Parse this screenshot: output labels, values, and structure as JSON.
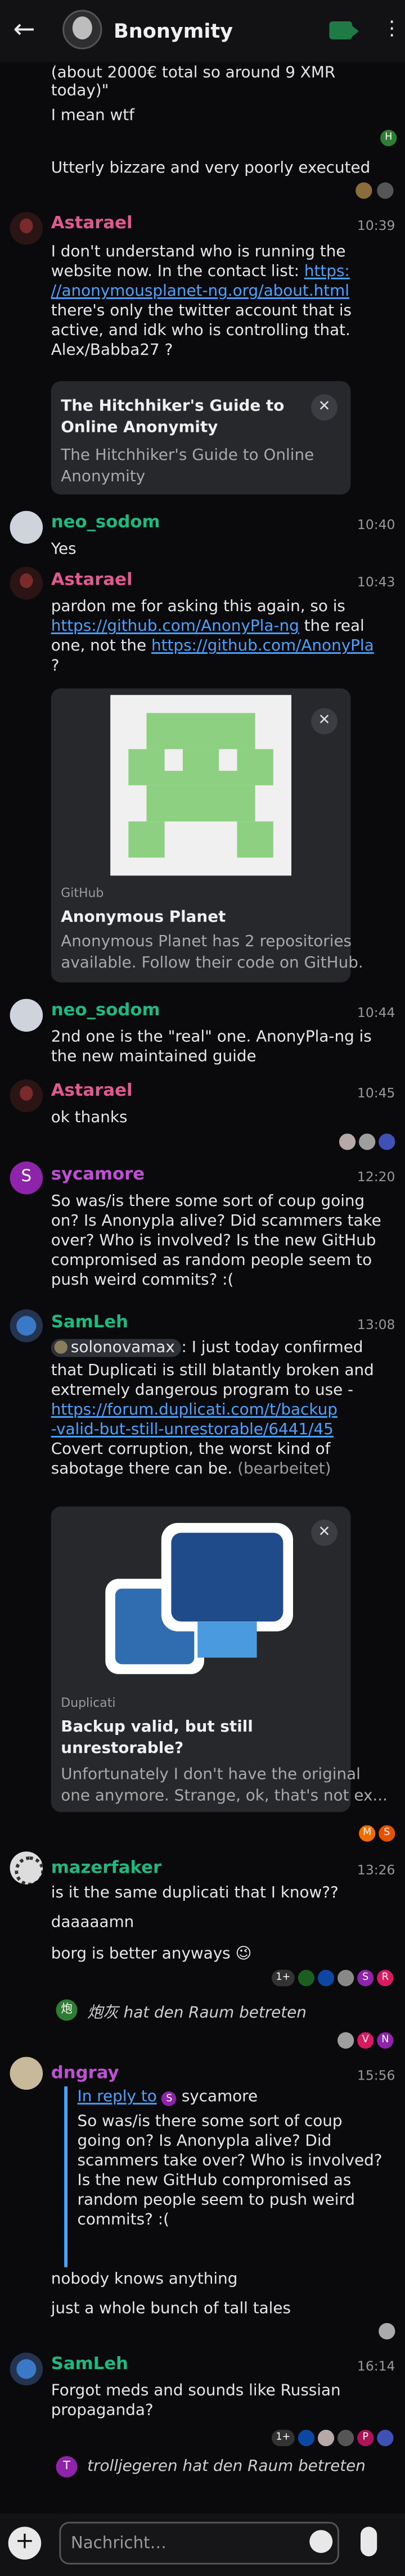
{
  "header": {
    "room_title": "Bnonymity",
    "icons": [
      "arrow-left-icon",
      "room-avatar",
      "video-call-icon",
      "kebab-menu-icon"
    ],
    "accent_color": "#1f7a46"
  },
  "colors": {
    "background": "#0a0a0c",
    "link": "#4aa3ff",
    "astarael": "#e05a8f",
    "neo_sodom": "#1eb980",
    "sycamore": "#c04fd6",
    "samleh": "#1eb980",
    "mazerfaker": "#1eb980",
    "dngray": "#c04fd6",
    "card_bg": "#27282c"
  },
  "messages": {
    "m0": {
      "lines": [
        "(about 2000€ total so around 9 XMR",
        "today)\""
      ]
    },
    "m1": {
      "text": "I mean wtf",
      "read_badge": "H"
    },
    "m2": {
      "text": "Utterly bizzare and very poorly executed"
    },
    "m3": {
      "sender": "Astarael",
      "time": "10:39",
      "line1": "I don't understand who is running the",
      "line2_pre": "website now. In the contact list: ",
      "line2_link": "https:",
      "line3_link": "//anonymousplanet-ng.org/about.html",
      "line4": "there's only the twitter account that is",
      "line5": "active, and idk who is controlling that.",
      "line6": "Alex/Babba27 ?",
      "card": {
        "title_line1": "The Hitchhiker's Guide to",
        "title_line2": "Online Anonymity",
        "desc_line1": "The Hitchhiker's Guide to Online",
        "desc_line2": "Anonymity",
        "close": "✕"
      }
    },
    "m4": {
      "sender": "neo_sodom",
      "time": "10:40",
      "text": "Yes"
    },
    "m5": {
      "sender": "Astarael",
      "time": "10:43",
      "line1": "pardon me for asking this again, so is",
      "line2_link": "https://github.com/AnonyPla-ng",
      "line2_post": " the real",
      "line3_pre": "one, not the ",
      "line3_link": "https://github.com/AnonyPla",
      "line4": "?",
      "card": {
        "site": "GitHub",
        "title": "Anonymous Planet",
        "desc_line1": "Anonymous Planet has 2 repositories",
        "desc_line2": "available. Follow their code on GitHub.",
        "close": "✕"
      }
    },
    "m6": {
      "sender": "neo_sodom",
      "time": "10:44",
      "line1": "2nd one is the \"real\" one. AnonyPla-ng is",
      "line2": "the new maintained guide"
    },
    "m7": {
      "sender": "Astarael",
      "time": "10:45",
      "text": "ok thanks"
    },
    "m8": {
      "sender": "sycamore",
      "avatar_letter": "S",
      "time": "12:20",
      "line1": "So was/is there some sort of coup going",
      "line2": "on? Is Anonypla alive? Did scammers take",
      "line3": "over? Who is involved? Is the new GitHub",
      "line4": "compromised as random people seem to",
      "line5": "push weird commits? :("
    },
    "m9": {
      "sender": "SamLeh",
      "time": "13:08",
      "mention": "solonovamax",
      "line1_post": ": I just today confirmed",
      "line2": "that Duplicati is still blatantly broken and",
      "line3": "extremely dangerous program to use -",
      "line4_link": "https://forum.duplicati.com/t/backup",
      "line5_link": "-valid-but-still-unrestorable/6441/45",
      "line6": "Covert corruption, the worst kind of",
      "line7_pre": "sabotage there can be. ",
      "edited": "(bearbeitet)",
      "card": {
        "site": "Duplicati",
        "title_line1": "Backup valid, but still",
        "title_line2": "unrestorable?",
        "desc_line1": "Unfortunately I don't have the original",
        "desc_line2": "one anymore. Strange, ok, that's not ex...",
        "close": "✕"
      },
      "read_badges": [
        "M",
        "S"
      ]
    },
    "m10": {
      "sender": "mazerfaker",
      "time": "13:26",
      "line1": "is it the same duplicati that I know??",
      "line2": "daaaaamn",
      "line3": "borg is better anyways 😉",
      "reactions_more": "1+",
      "reaction_letters": [
        "S",
        "R"
      ]
    },
    "sys1": {
      "avatar_letter": "炮",
      "text": "炮灰 hat den Raum betreten",
      "read_letters": [
        "V",
        "N"
      ]
    },
    "m11": {
      "sender": "dngray",
      "time": "15:56",
      "reply_label": "In reply to",
      "reply_avatar_letter": "S",
      "reply_to": "sycamore",
      "q1": "So was/is there some sort of coup",
      "q2": "going on? Is Anonypla alive? Did",
      "q3": "scammers take over? Who is involved?",
      "q4": "Is the new GitHub compromised as",
      "q5": "random people seem to push weird",
      "q6": "commits? :(",
      "line1": "nobody knows anything",
      "line2": "just a whole bunch of tall tales"
    },
    "m12": {
      "sender": "SamLeh",
      "time": "16:14",
      "line1": "Forgot meds and sounds like Russian",
      "line2": "propaganda?",
      "reactions_more": "1+",
      "reaction_letter": "P"
    },
    "sys2": {
      "avatar_letter": "T",
      "text": "trolljegeren hat den Raum betreten"
    }
  },
  "composer": {
    "placeholder": "Nachricht…",
    "plus": "+",
    "icons": [
      "add-attachment-icon",
      "emoji-icon",
      "microphone-icon"
    ]
  }
}
